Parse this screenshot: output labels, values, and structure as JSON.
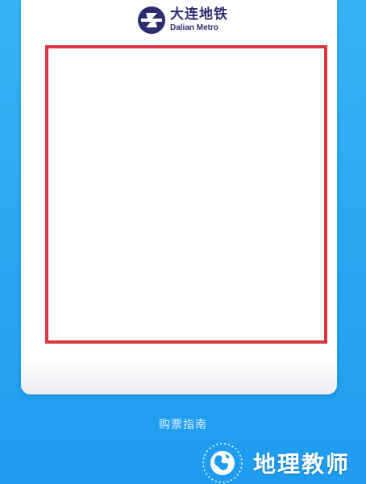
{
  "brand": {
    "name_cn": "大连地铁",
    "name_en": "Dalian Metro",
    "color": "#2b2e6e",
    "logo_icon": "metro-logo-icon"
  },
  "qr": {
    "frame_color": "#d9363e",
    "icon": "qr-code-area"
  },
  "guide": {
    "label": "购票指南"
  },
  "watermark": {
    "text": "地理教师",
    "seal_icon": "globe-seal-icon"
  },
  "colors": {
    "background": "#2aa8f3",
    "card": "#ffffff"
  }
}
